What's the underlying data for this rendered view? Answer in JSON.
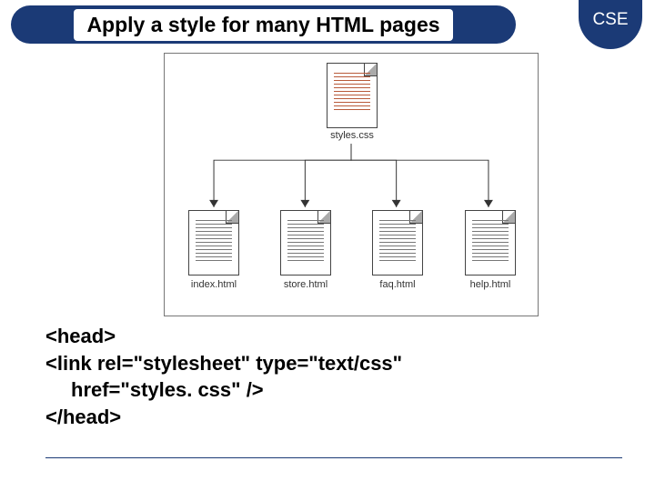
{
  "header": {
    "title": "Apply a style for many HTML pages"
  },
  "badge": {
    "text": "CSE"
  },
  "diagram": {
    "root_file": "styles.css",
    "children": [
      {
        "name": "index.html"
      },
      {
        "name": "store.html"
      },
      {
        "name": "faq.html"
      },
      {
        "name": "help.html"
      }
    ]
  },
  "code": {
    "line1": "<head>",
    "line2": "<link rel=\"stylesheet\" type=\"text/css\"",
    "line3": "href=\"styles. css\" />",
    "line4": "</head>"
  }
}
